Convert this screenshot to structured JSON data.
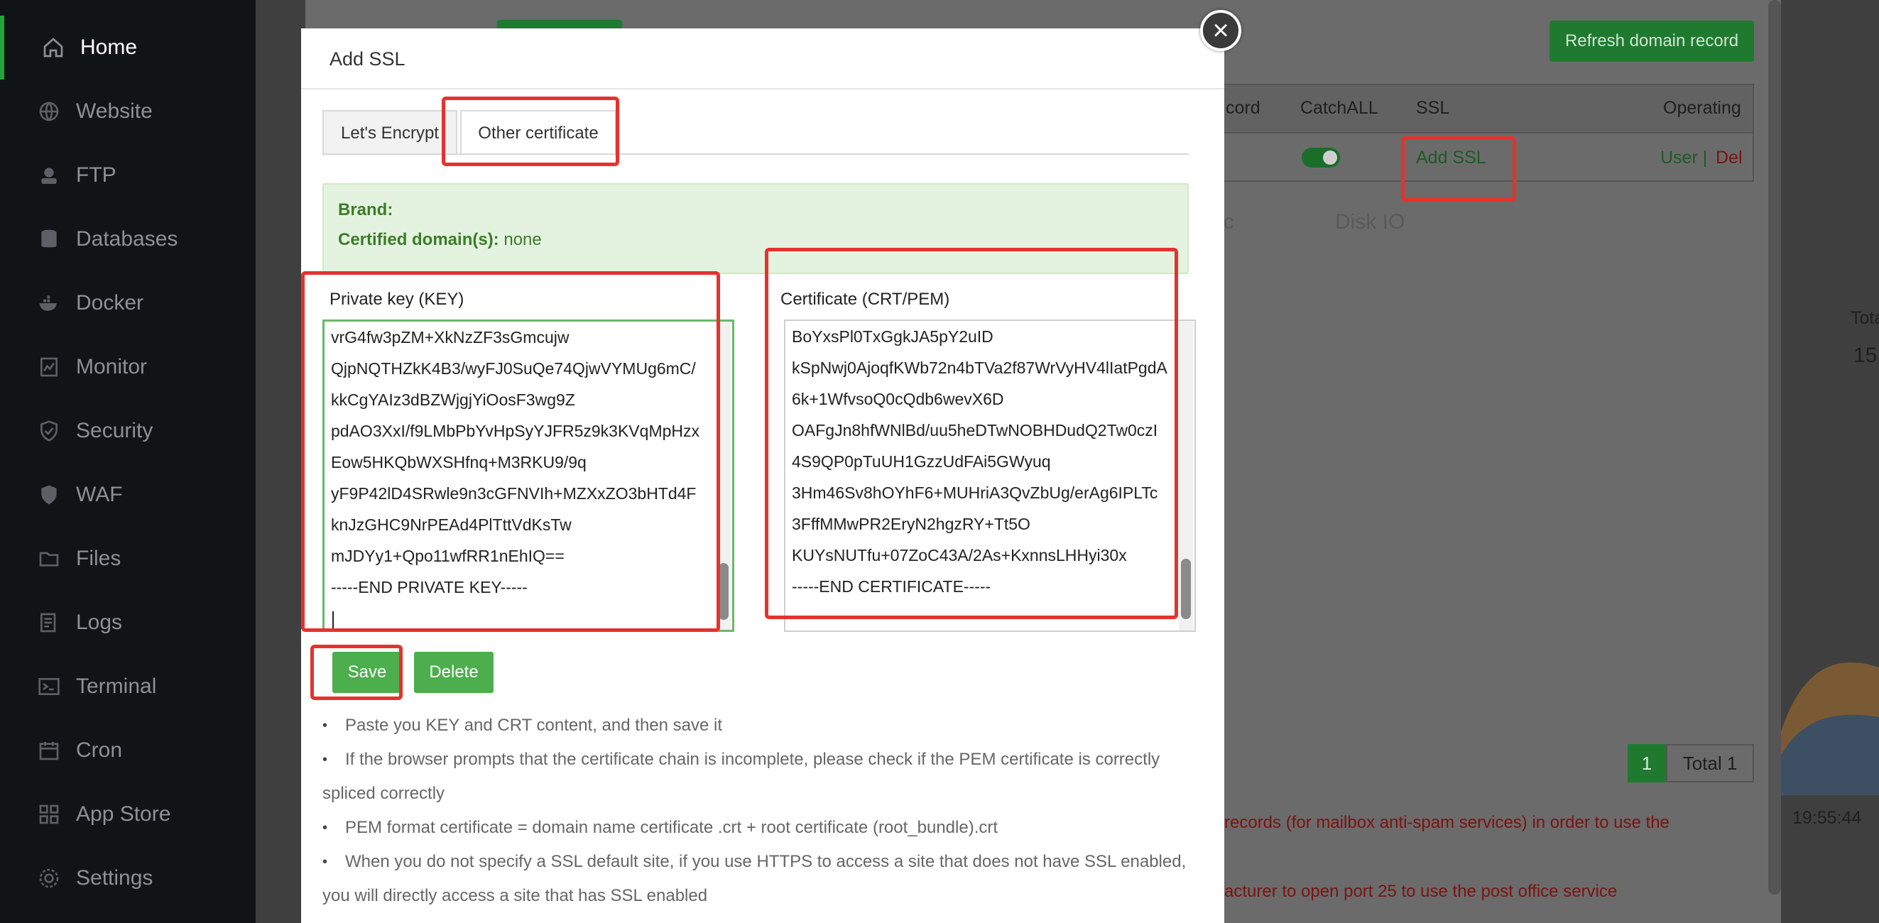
{
  "sidebar": {
    "items": [
      {
        "label": "Home",
        "icon": "home-icon",
        "active": true
      },
      {
        "label": "Website",
        "icon": "globe-icon"
      },
      {
        "label": "FTP",
        "icon": "ftp-icon"
      },
      {
        "label": "Databases",
        "icon": "database-icon"
      },
      {
        "label": "Docker",
        "icon": "docker-icon"
      },
      {
        "label": "Monitor",
        "icon": "monitor-icon"
      },
      {
        "label": "Security",
        "icon": "shield-check-icon"
      },
      {
        "label": "WAF",
        "icon": "waf-shield-icon"
      },
      {
        "label": "Files",
        "icon": "folder-icon"
      },
      {
        "label": "Logs",
        "icon": "logs-icon"
      },
      {
        "label": "Terminal",
        "icon": "terminal-icon"
      },
      {
        "label": "Cron",
        "icon": "calendar-icon"
      },
      {
        "label": "App Store",
        "icon": "grid-icon"
      },
      {
        "label": "Settings",
        "icon": "gear-icon"
      }
    ]
  },
  "background": {
    "refresh_label": "Refresh domain record",
    "table_headers": {
      "record": "cord",
      "catchall": "CatchALL",
      "ssl": "SSL",
      "operating": "Operating"
    },
    "row": {
      "ssl_link": "Add SSL",
      "user_link": "User |",
      "del_link": "Del"
    },
    "pagination": {
      "page": "1",
      "total": "Total 1"
    },
    "time_label": "19:55:44",
    "side_value": "15",
    "tota_label": "Tota",
    "red_text_1": "records (for mailbox anti-spam services) in order to use the",
    "red_text_2": "acturer to open port 25 to use the post office service",
    "faded_1": "ffic",
    "faded_2": "Disk IO"
  },
  "modal": {
    "title": "Add SSL",
    "close_glyph": "×",
    "tabs": [
      {
        "label": "Let's Encrypt"
      },
      {
        "label": "Other certificate",
        "active": true
      }
    ],
    "cert_info": {
      "brand_label": "Brand:",
      "brand_value": "",
      "domains_label": "Certified domain(s):",
      "domains_value": "none"
    },
    "private_key": {
      "label": "Private key (KEY)",
      "lines": [
        "vrG4fw3pZM+XkNzZF3sGmcujw",
        "QjpNQTHZkK4B3/wyFJ0SuQe74QjwVYMUg6mC/",
        "kkCgYAIz3dBZWjgjYiOosF3wg9Z",
        "pdAO3XxI/f9LMbPbYvHpSyYJFR5z9k3KVqMpHzx",
        "Eow5HKQbWXSHfnq+M3RKU9/9q",
        "yF9P42lD4SRwle9n3cGFNVIh+MZXxZO3bHTd4F",
        "knJzGHC9NrPEAd4PlTttVdKsTw",
        "mJDYy1+Qpo11wfRR1nEhIQ==",
        "-----END PRIVATE KEY-----"
      ]
    },
    "certificate": {
      "label": "Certificate (CRT/PEM)",
      "lines": [
        "BoYxsPl0TxGgkJA5pY2uID",
        "kSpNwj0AjoqfKWb72n4bTVa2f87WrVyHV4lIatPgdA",
        "6k+1WfvsoQ0cQdb6wevX6D",
        "OAFgJn8hfWNlBd/uu5heDTwNOBHDudQ2Tw0czI",
        "4S9QP0pTuUH1GzzUdFAi5GWyuq",
        "3Hm46Sv8hOYhF6+MUHriA3QvZbUg/erAg6IPLTc",
        "3FffMMwPR2EryN2hgzRY+Tt5O",
        "KUYsNUTfu+07ZoC43A/2As+KxnnsLHHyi30x",
        "-----END CERTIFICATE-----"
      ]
    },
    "buttons": {
      "save": "Save",
      "delete": "Delete"
    },
    "tips": [
      "Paste you KEY and CRT content, and then save it",
      "If the browser prompts that the certificate chain is incomplete, please check if the PEM certificate is correctly",
      "spliced correctly",
      "PEM format certificate = domain name certificate .crt + root certificate (root_bundle).crt",
      "When you do not specify a SSL default site, if you use HTTPS to access a site that does not have SSL enabled,",
      "you will directly access a site that has SSL enabled"
    ]
  },
  "colors": {
    "accent": "#20a53a",
    "button_green": "#4cae4c",
    "annotation_red": "#e5322d",
    "info_bg": "#e4f3df"
  }
}
